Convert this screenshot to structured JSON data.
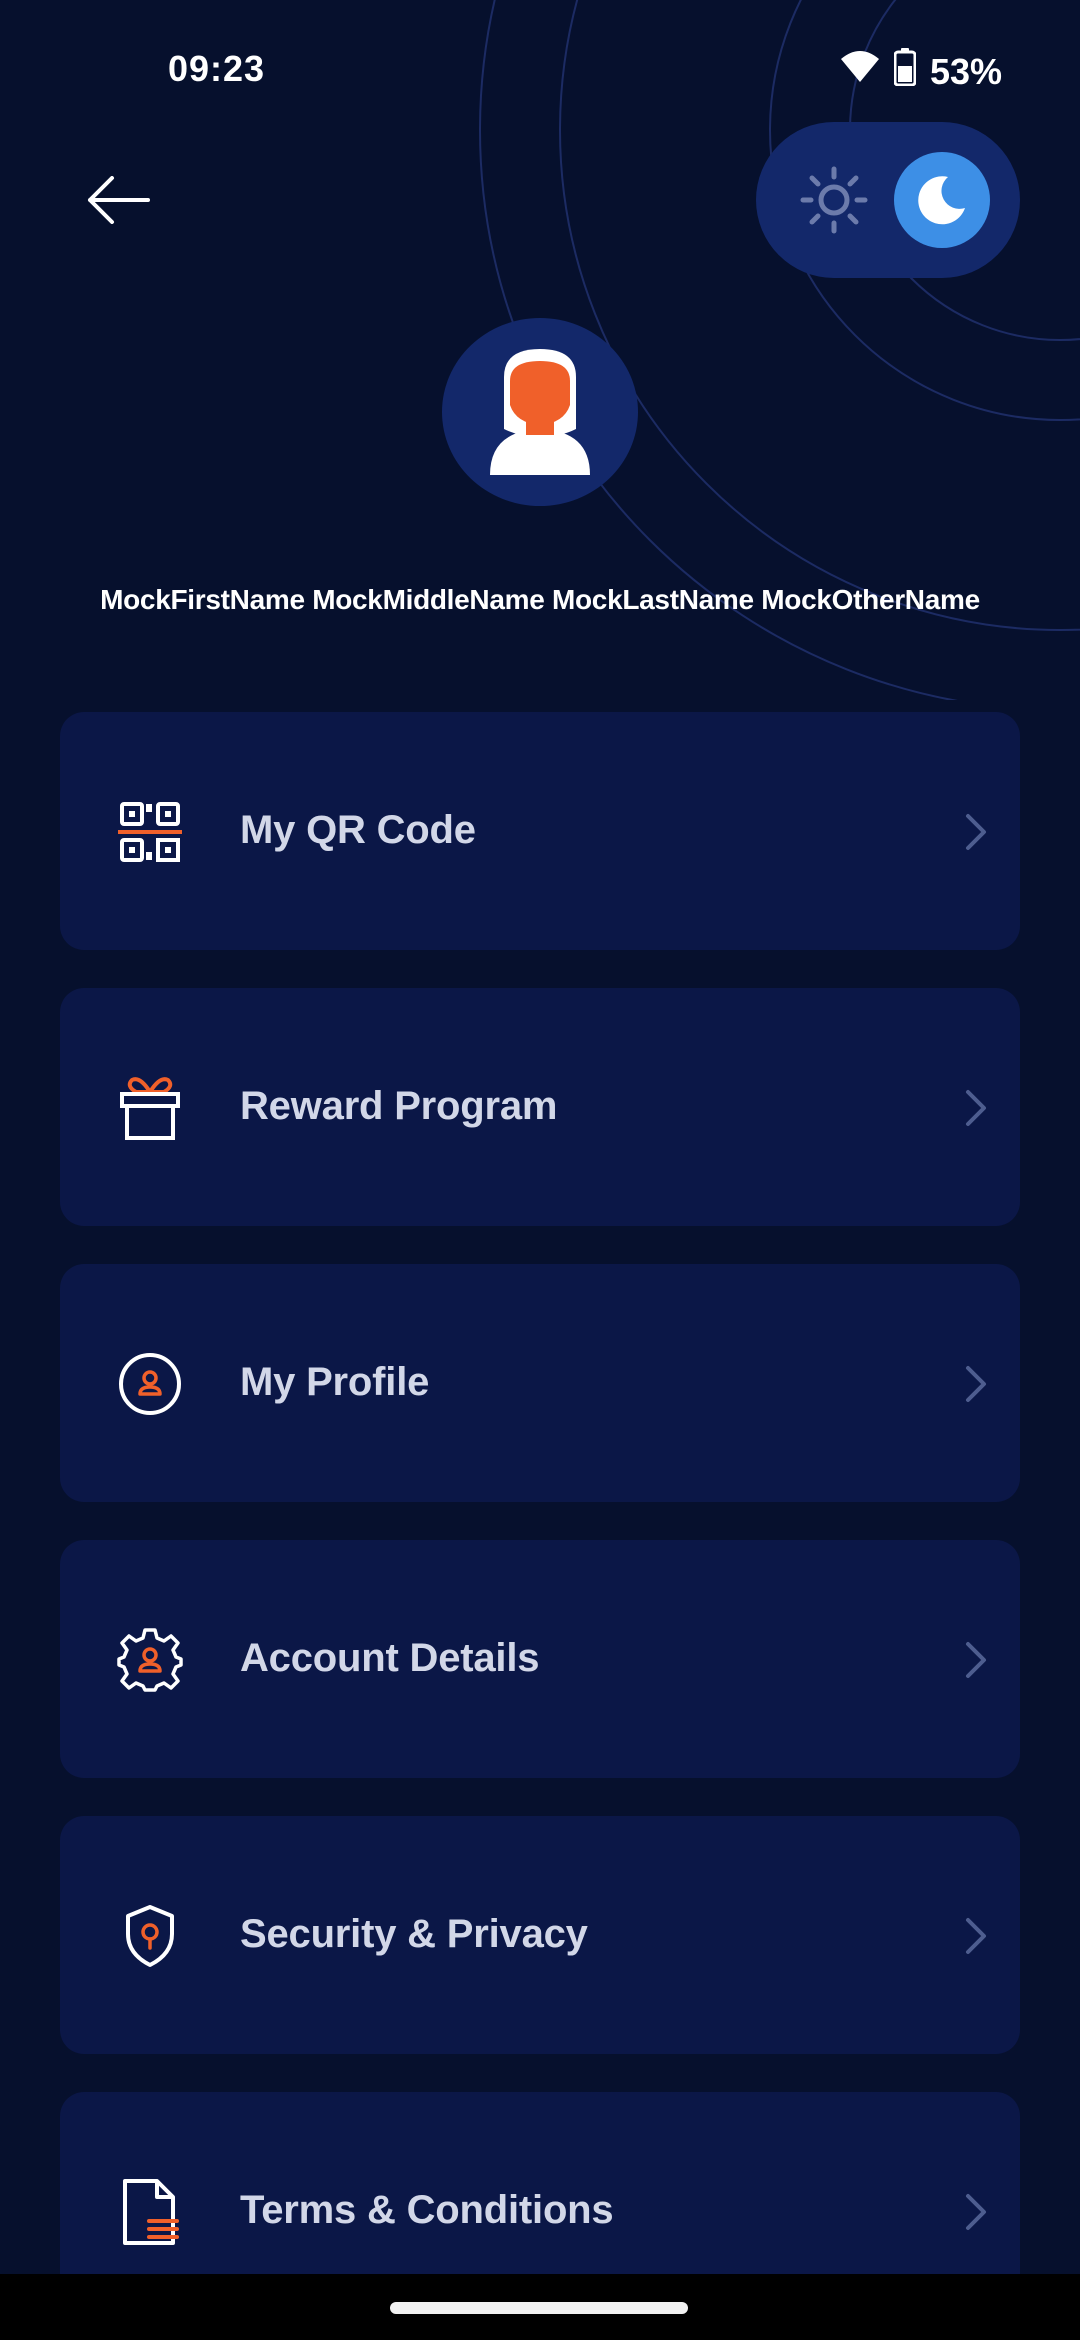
{
  "status_bar": {
    "time": "09:23",
    "battery": "53%",
    "icons": [
      "wifi-icon",
      "battery-icon"
    ]
  },
  "header": {
    "back_icon": "arrow-left-icon",
    "theme_toggle": {
      "options": [
        "sun-icon",
        "moon-icon"
      ],
      "selected": "dark"
    }
  },
  "profile": {
    "avatar_icon": "user-avatar-icon",
    "name": "MockFirstName MockMiddleName MockLastName MockOtherName"
  },
  "menu": {
    "items": [
      {
        "label": "My QR Code",
        "icon": "qr-code-icon"
      },
      {
        "label": "Reward Program",
        "icon": "gift-icon"
      },
      {
        "label": "My Profile",
        "icon": "profile-icon"
      },
      {
        "label": "Account Details",
        "icon": "gear-user-icon"
      },
      {
        "label": "Security & Privacy",
        "icon": "shield-lock-icon"
      },
      {
        "label": "Terms & Conditions",
        "icon": "document-icon"
      }
    ],
    "chevron_icon": "chevron-right-icon"
  },
  "colors": {
    "background": "#06102d",
    "card": "#0b1747",
    "toggle_track": "#13286a",
    "accent_blue": "#3d8fe6",
    "accent_orange": "#f0602a",
    "text": "#d2d7e8"
  }
}
